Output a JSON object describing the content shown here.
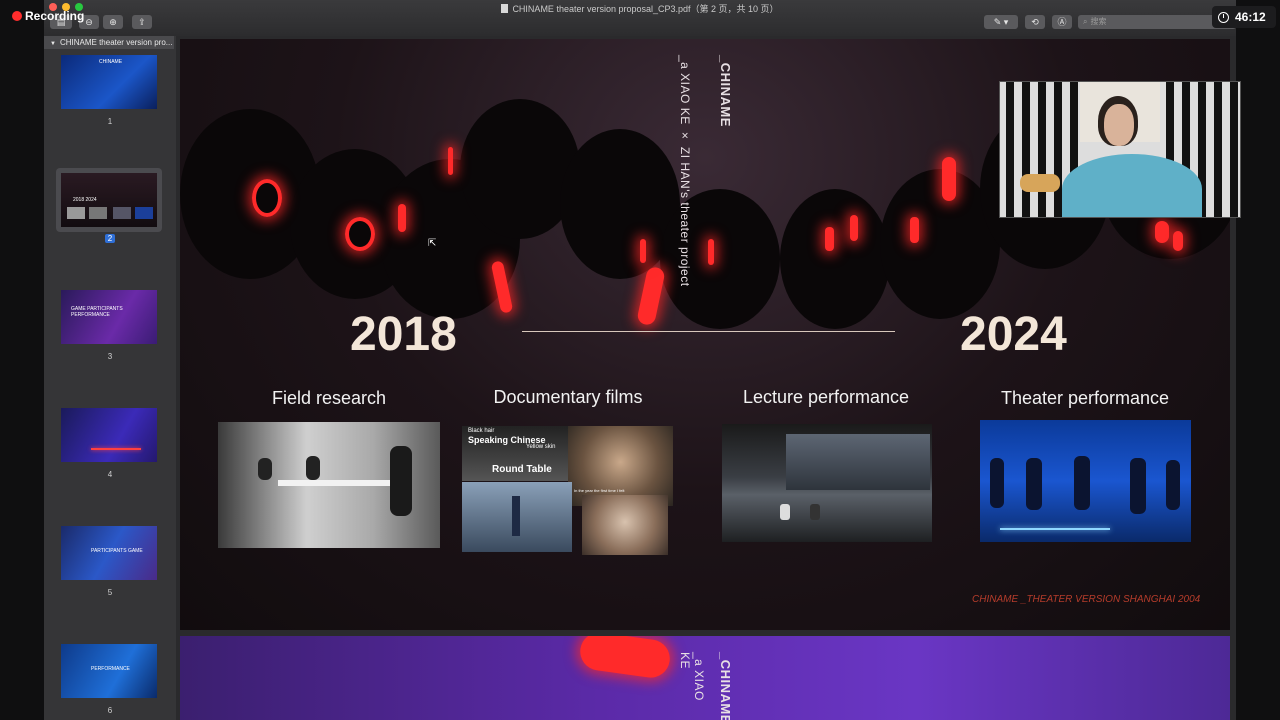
{
  "overlay": {
    "recording_label": "Recording",
    "timer": "46:12"
  },
  "window": {
    "title": "CHINAME theater version proposal_CP3.pdf（第 2 页，共 10 页）",
    "search_placeholder": "搜索"
  },
  "sidebar": {
    "header": "CHINAME theater version pro...",
    "thumbnails": [
      {
        "num": "1",
        "label": "CHINAME"
      },
      {
        "num": "2",
        "label": "2018 2024"
      },
      {
        "num": "3",
        "label": "GAME PARTICIPANTS PERFORMANCE"
      },
      {
        "num": "4",
        "label": ""
      },
      {
        "num": "5",
        "label": "PARTICIPANTS GAME"
      },
      {
        "num": "6",
        "label": "PERFORMANCE"
      }
    ],
    "selected": "2"
  },
  "slide": {
    "vertical_brand": "_CHINAME",
    "vertical_sub": "_a  XIAO KE  ×  ZI HAN's  theater project",
    "year_start": "2018",
    "year_end": "2024",
    "columns": [
      {
        "title": "Field research"
      },
      {
        "title": "Documentary films"
      },
      {
        "title": "Lecture performance"
      },
      {
        "title": "Theater performance"
      }
    ],
    "doc_film_labels": {
      "black_hair": "Black hair",
      "speaking_chinese": "Speaking Chinese",
      "yellow_skin": "Yellow skin",
      "round_table": "Round Table",
      "caption": "In the year the first time I felt"
    },
    "footnote": "CHINAME _THEATER VERSION SHANGHAI 2004"
  },
  "slide2": {
    "vertical_brand": "_CHINAME",
    "vertical_sub": "_a  XIAO KE"
  }
}
